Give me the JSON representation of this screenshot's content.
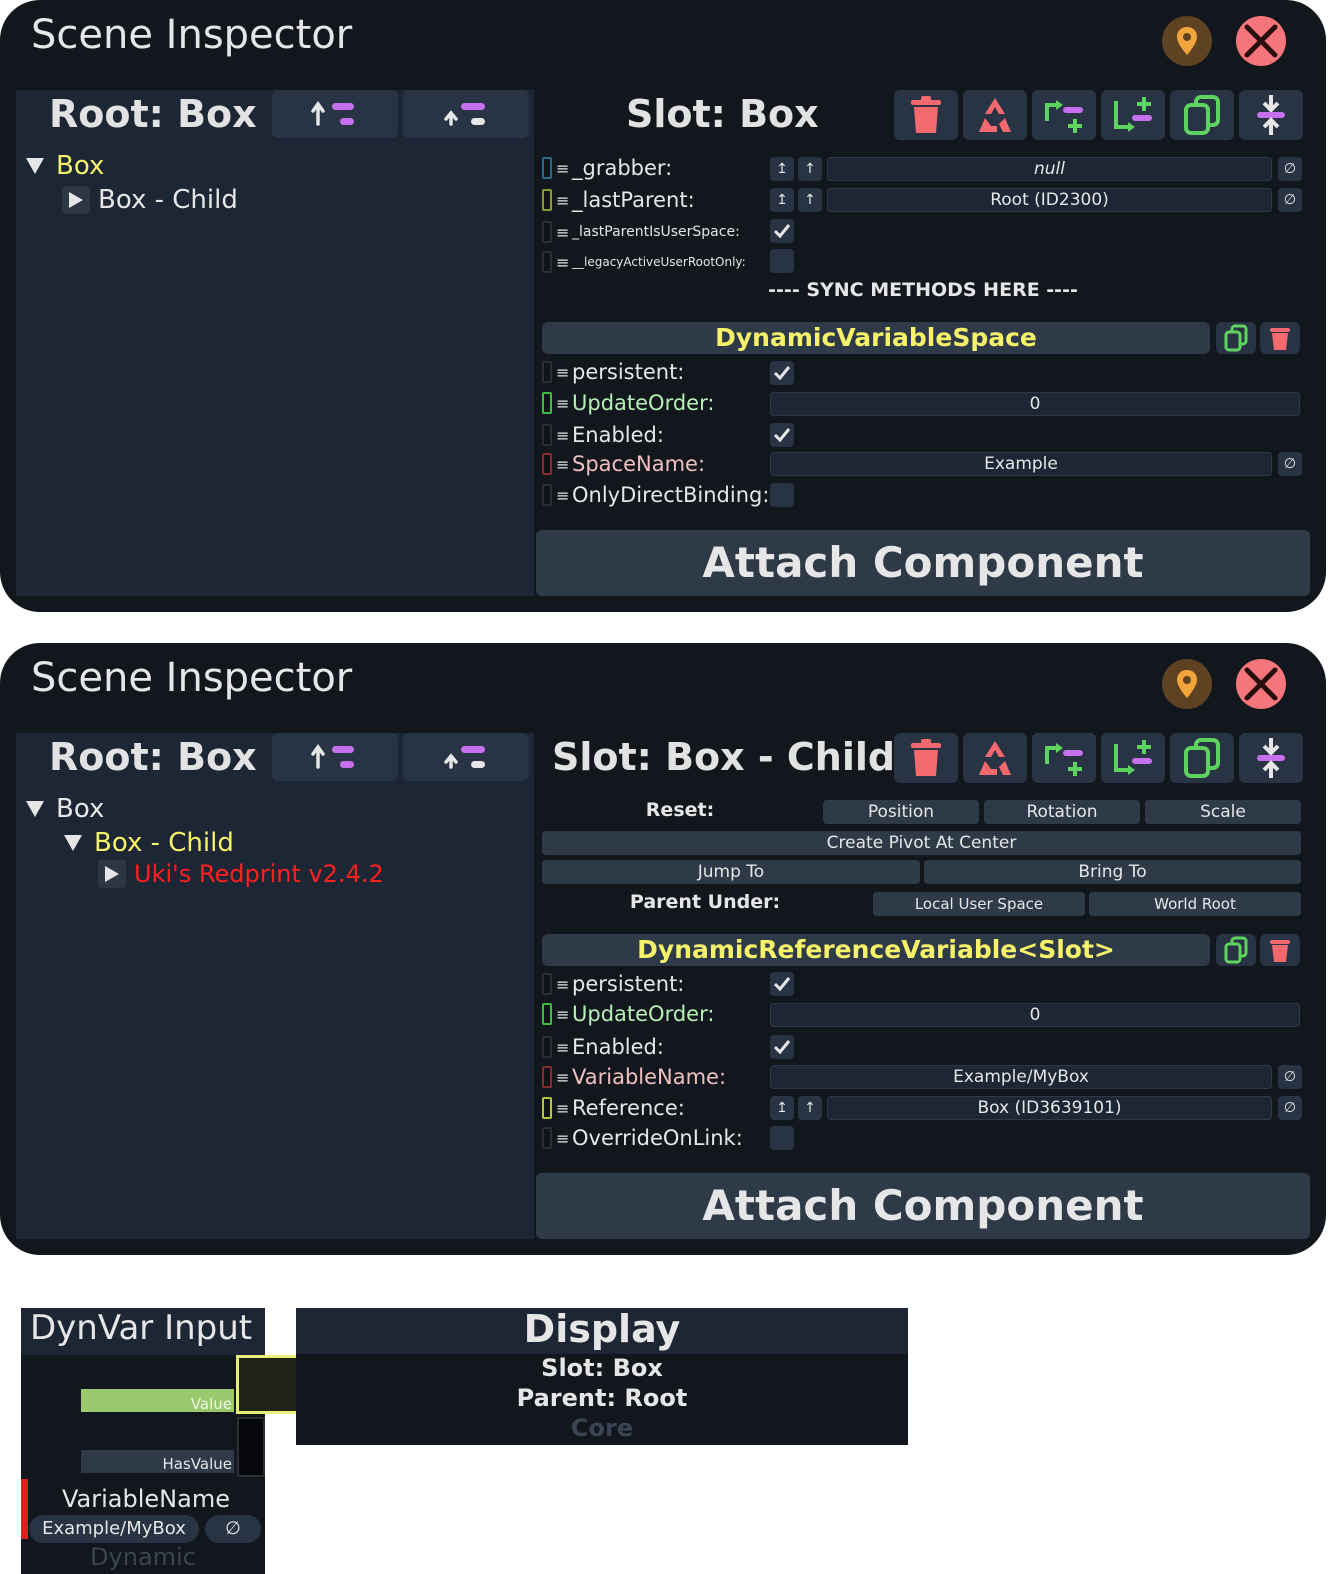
{
  "colors": {
    "accent_yellow": "#f6f26a",
    "red_label": "#ff1f1f",
    "value_green": "#9ac86c"
  },
  "panel1": {
    "title": "Scene Inspector",
    "root_label": "Root: Box",
    "tree": [
      {
        "label": "Box",
        "selected": true
      },
      {
        "label": "Box - Child"
      }
    ],
    "slot_title": "Slot: Box",
    "fields_top": [
      {
        "label": "_grabber:",
        "value": "null"
      },
      {
        "label": "_lastParent:",
        "value": "Root (ID2300)"
      },
      {
        "label": "_lastParentIsUserSpace:"
      },
      {
        "label": "__legacyActiveUserRootOnly:"
      }
    ],
    "sync_text": "---- SYNC METHODS HERE ----",
    "component_name": "DynamicVariableSpace",
    "fields": [
      {
        "label": "persistent:"
      },
      {
        "label": "UpdateOrder:",
        "value": "0"
      },
      {
        "label": "Enabled:"
      },
      {
        "label": "SpaceName:",
        "value": "Example"
      },
      {
        "label": "OnlyDirectBinding:"
      }
    ],
    "attach_label": "Attach Component"
  },
  "panel2": {
    "title": "Scene Inspector",
    "root_label": "Root: Box",
    "tree": [
      {
        "label": "Box"
      },
      {
        "label": "Box - Child",
        "selected": true
      },
      {
        "label": "Uki's Redprint v2.4.2"
      }
    ],
    "slot_title": "Slot: Box - Child",
    "reset_label": "Reset:",
    "reset_buttons": [
      "Position",
      "Rotation",
      "Scale"
    ],
    "create_pivot": "Create Pivot At Center",
    "jump_to": "Jump To",
    "bring_to": "Bring To",
    "parent_under": "Parent Under:",
    "local_user_space": "Local User Space",
    "world_root": "World Root",
    "component_name": "DynamicReferenceVariable<Slot>",
    "fields": [
      {
        "label": "persistent:"
      },
      {
        "label": "UpdateOrder:",
        "value": "0"
      },
      {
        "label": "Enabled:"
      },
      {
        "label": "VariableName:",
        "value": "Example/MyBox"
      },
      {
        "label": "Reference:",
        "value": "Box (ID3639101)"
      },
      {
        "label": "OverrideOnLink:"
      }
    ],
    "attach_label": "Attach Component"
  },
  "node_input": {
    "title": "DynVar Input",
    "value_label": "Value",
    "hasvalue_label": "HasValue",
    "variable_name_label": "VariableName",
    "variable_name_value": "Example/MyBox",
    "null_symbol": "∅",
    "category": "Dynamic"
  },
  "node_display": {
    "title": "Display",
    "line1": "Slot: Box",
    "line2": "Parent: Root",
    "category": "Core"
  }
}
